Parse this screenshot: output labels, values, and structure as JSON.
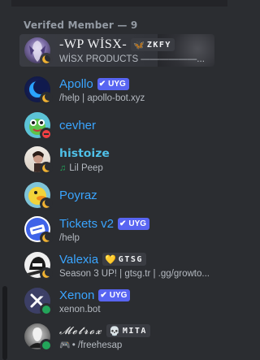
{
  "section": {
    "title": "Verifed Member — 9"
  },
  "members": [
    {
      "name": "-WP WİSX-",
      "sub": "WİSX PRODUCTS ——————...",
      "tag": {
        "icon": "🦋",
        "text": "ZKFY"
      },
      "status": "idle"
    },
    {
      "name": "Apollo",
      "sub": "/help | apollo-bot.xyz",
      "bot_label": "UYG",
      "status": "idle"
    },
    {
      "name": "cevher",
      "sub": "",
      "status": "dnd"
    },
    {
      "name": "𝗵𝗶𝘀𝘁𝗼𝗶𝘇𝗲",
      "sub": "Lil Peep",
      "status": "idle"
    },
    {
      "name": "Poyraz",
      "sub": "",
      "status": "idle"
    },
    {
      "name": "Tickets v2",
      "sub": "/help",
      "bot_label": "UYG",
      "status": "idle"
    },
    {
      "name": "Valexia",
      "sub": "Season 3 UP! | gtsg.tr | .gg/growto...",
      "tag": {
        "icon": "💛",
        "text": "GTSG"
      },
      "status": "idle"
    },
    {
      "name": "Xenon",
      "sub": "xenon.bot",
      "bot_label": "UYG",
      "status": "online"
    },
    {
      "name": "𝓜𝓮𝓽𝓻𝓸𝔁",
      "sub": "• /freehesap",
      "tag": {
        "icon": "💀",
        "text": "MITA"
      },
      "status": "online"
    }
  ],
  "icons": {
    "check": "✔",
    "music": "♫",
    "game": "🎮"
  },
  "colors": {
    "background": "#2b2d31",
    "name_blue": "#3aa5ff",
    "bot_tag": "#5865f2",
    "online": "#23a55a",
    "idle": "#f0b232",
    "dnd": "#f23f43"
  }
}
